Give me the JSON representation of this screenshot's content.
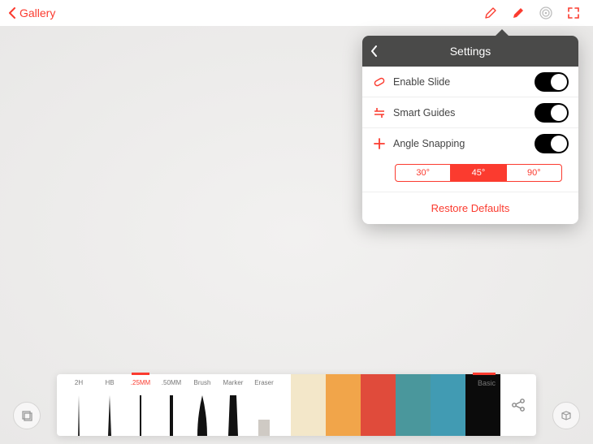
{
  "accent": "#fb3b2f",
  "topbar": {
    "back_label": "Gallery"
  },
  "settings": {
    "title": "Settings",
    "rows": {
      "slide": "Enable Slide",
      "guides": "Smart Guides",
      "snap": "Angle Snapping"
    },
    "angles": [
      "30°",
      "45°",
      "90°"
    ],
    "angle_selected": 1,
    "restore": "Restore Defaults"
  },
  "tools": {
    "items": [
      "2H",
      "HB",
      ".25MM",
      ".50MM",
      "Brush",
      "Marker",
      "Eraser"
    ],
    "selected": 2
  },
  "palette": {
    "label": "Basic",
    "colors": [
      "#f3e7c9",
      "#f1a54a",
      "#e04b3b",
      "#4a979c",
      "#419bb3",
      "#0b0b0b"
    ]
  }
}
